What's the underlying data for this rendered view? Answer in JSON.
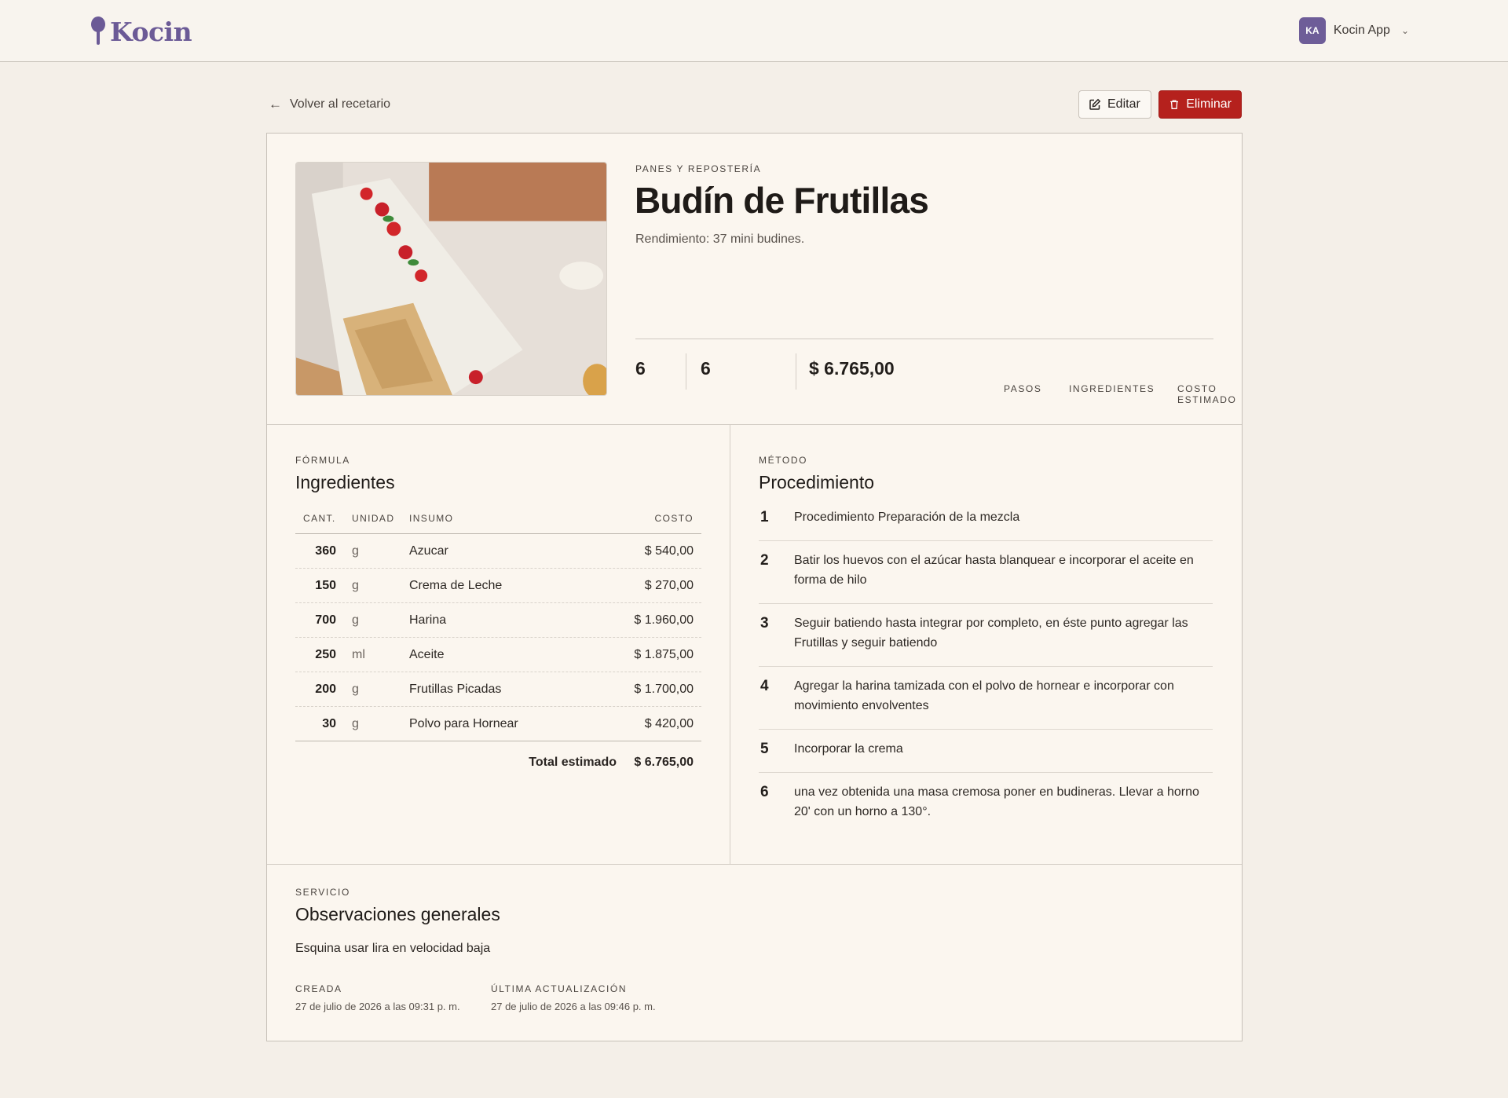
{
  "header": {
    "brand": "Kocin",
    "user_initials": "KA",
    "user_name": "Kocin App"
  },
  "actions": {
    "back_label": "Volver al recetario",
    "edit_label": "Editar",
    "delete_label": "Eliminar"
  },
  "recipe": {
    "category": "PANES Y REPOSTERÍA",
    "title": "Budín de Frutillas",
    "yield": "Rendimiento: 37 mini budines.",
    "stats": [
      {
        "label": "PASOS",
        "value": "6"
      },
      {
        "label": "INGREDIENTES",
        "value": "6"
      },
      {
        "label": "COSTO ESTIMADO",
        "value": "$ 6.765,00"
      }
    ]
  },
  "ingredients": {
    "eyebrow": "FÓRMULA",
    "title": "Ingredientes",
    "columns": {
      "qty": "CANT.",
      "unit": "UNIDAD",
      "name": "INSUMO",
      "cost": "COSTO"
    },
    "rows": [
      {
        "qty": "360",
        "unit": "g",
        "name": "Azucar",
        "cost": "$ 540,00"
      },
      {
        "qty": "150",
        "unit": "g",
        "name": "Crema de Leche",
        "cost": "$ 270,00"
      },
      {
        "qty": "700",
        "unit": "g",
        "name": "Harina",
        "cost": "$ 1.960,00"
      },
      {
        "qty": "250",
        "unit": "ml",
        "name": "Aceite",
        "cost": "$ 1.875,00"
      },
      {
        "qty": "200",
        "unit": "g",
        "name": "Frutillas Picadas",
        "cost": "$ 1.700,00"
      },
      {
        "qty": "30",
        "unit": "g",
        "name": "Polvo para Hornear",
        "cost": "$ 420,00"
      }
    ],
    "total_label": "Total estimado",
    "total_value": "$ 6.765,00"
  },
  "procedure": {
    "eyebrow": "MÉTODO",
    "title": "Procedimiento",
    "steps": [
      {
        "num": "1",
        "text": "Procedimiento Preparación de la mezcla"
      },
      {
        "num": "2",
        "text": "Batir los huevos con el azúcar hasta blanquear e incorporar el aceite en forma de hilo"
      },
      {
        "num": "3",
        "text": "Seguir batiendo hasta integrar por completo, en éste punto agregar las Frutillas y seguir batiendo"
      },
      {
        "num": "4",
        "text": "Agregar la harina tamizada con el polvo de hornear e incorporar con movimiento envolventes"
      },
      {
        "num": "5",
        "text": "Incorporar la crema"
      },
      {
        "num": "6",
        "text": "una vez obtenida una masa cremosa poner en budineras. Llevar a horno 20' con un horno a 130°."
      }
    ]
  },
  "notes": {
    "eyebrow": "SERVICIO",
    "title": "Observaciones generales",
    "text": "Esquina usar lira en velocidad baja",
    "created_label": "CREADA",
    "created_value": "27 de julio de 2026 a las 09:31 p. m.",
    "updated_label": "ÚLTIMA ACTUALIZACIÓN",
    "updated_value": "27 de julio de 2026 a las 09:46 p. m."
  },
  "colors": {
    "brand": "#6b5a96",
    "danger": "#b5211d",
    "background": "#f4efe8",
    "card": "#fbf6ef"
  },
  "icons": [
    "whisk-logo-icon",
    "chevron-down-icon",
    "arrow-left-icon",
    "edit-icon",
    "trash-icon"
  ]
}
